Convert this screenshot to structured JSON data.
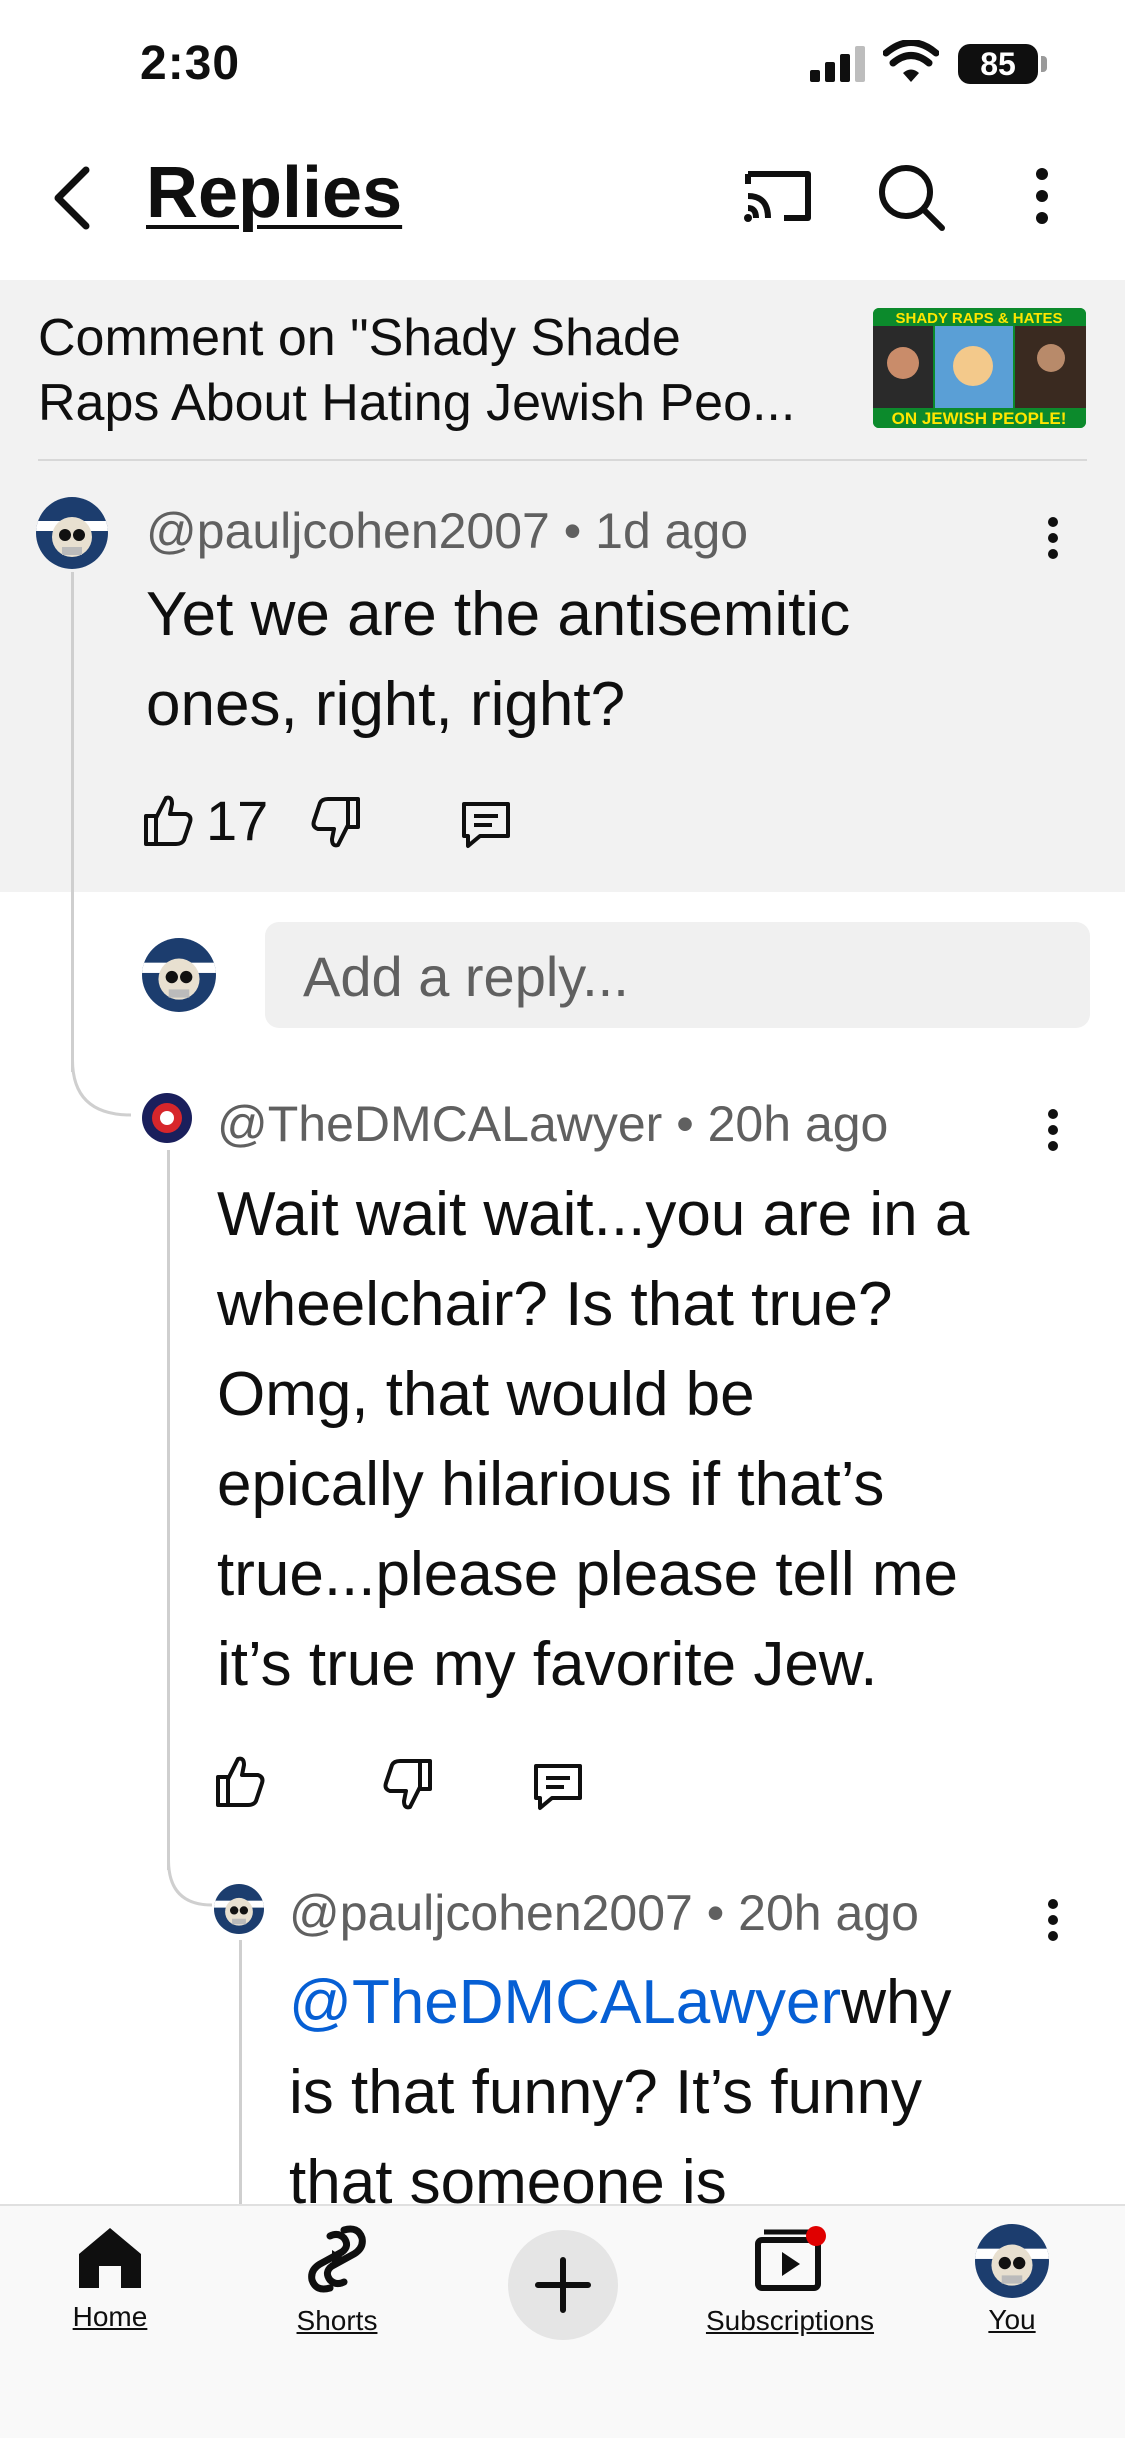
{
  "status_bar": {
    "time": "2:30",
    "battery": "85"
  },
  "header": {
    "title": "Replies"
  },
  "context": {
    "line1": "Comment on \"Shady Shade",
    "line2": "Raps About Hating Jewish Peo...",
    "thumbnail_text_top": "SHADY RAPS & HATES",
    "thumbnail_text_bottom": "ON JEWISH PEOPLE!"
  },
  "parent_comment": {
    "author": "@pauljcohen2007",
    "time": "1d ago",
    "text_line1": "Yet we are the antisemitic",
    "text_line2": "ones, right, right?",
    "likes": "17"
  },
  "reply_input": {
    "placeholder": "Add a reply..."
  },
  "replies": [
    {
      "author": "@TheDMCALawyer",
      "time": "20h ago",
      "lines": [
        "Wait wait wait...you are in a",
        "wheelchair? Is that true?",
        "Omg, that would be",
        "epically hilarious if that’s",
        "true...please please tell me",
        "it’s true my favorite Jew."
      ]
    },
    {
      "author": "@pauljcohen2007",
      "time": "20h ago",
      "mention": "@TheDMCALawyer",
      "line1_rest": "why",
      "line2": "is that funny?  It’s funny",
      "line3": "that someone is"
    }
  ],
  "bottom_nav": {
    "home": "Home",
    "shorts": "Shorts",
    "subscriptions": "Subscriptions",
    "you": "You"
  },
  "colors": {
    "accent_link": "#065fd4",
    "notification_dot": "#e00000"
  },
  "icons": [
    "back-icon",
    "cast-icon",
    "search-icon",
    "more-vert-icon",
    "thumb-up-icon",
    "thumb-down-icon",
    "reply-icon",
    "home-icon",
    "shorts-icon",
    "create-icon",
    "subscriptions-icon"
  ]
}
